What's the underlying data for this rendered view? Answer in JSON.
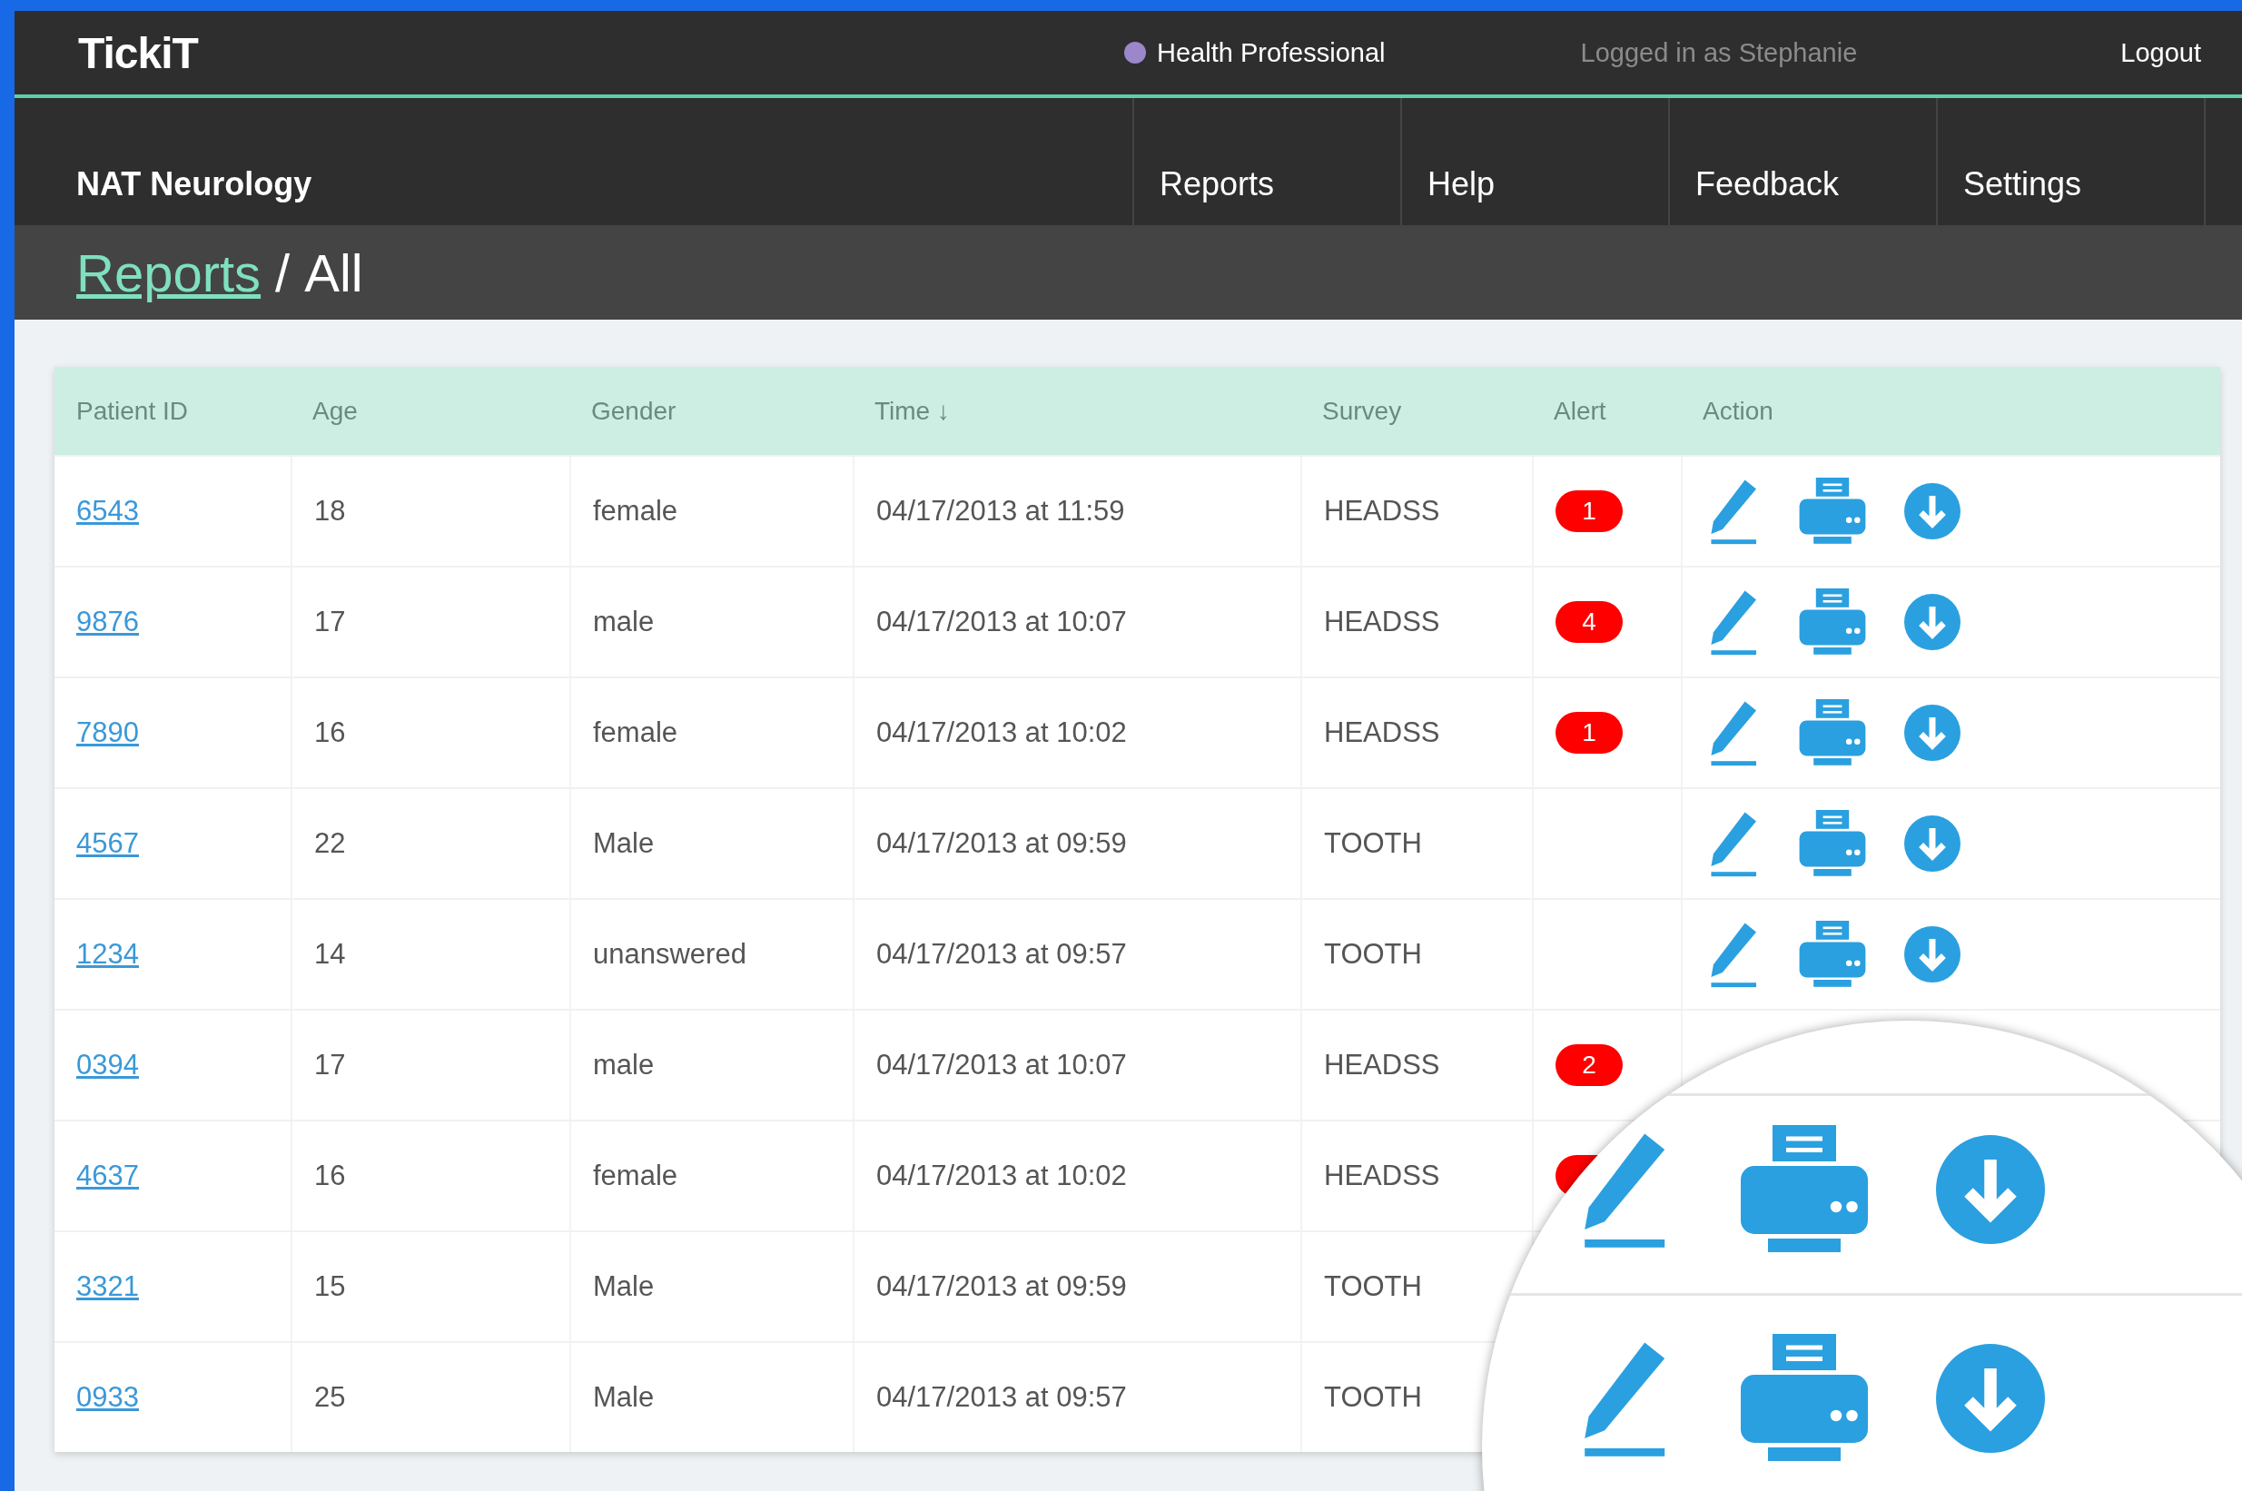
{
  "app": {
    "logo": "TickiT",
    "role": {
      "label": "Health Professional",
      "color": "#9b87c9"
    },
    "user": "Logged in as Stephanie",
    "logout": "Logout"
  },
  "nav": {
    "title": "NAT Neurology",
    "items": [
      {
        "label": "Reports",
        "selected": false
      },
      {
        "label": "Help",
        "selected": false
      },
      {
        "label": "Feedback",
        "selected": false
      },
      {
        "label": "Settings",
        "selected": false
      }
    ]
  },
  "breadcrumb": {
    "link": "Reports",
    "separator": "/",
    "current": "All"
  },
  "table": {
    "columns": [
      "Patient ID",
      "Age",
      "Gender",
      "Time ↓",
      "Survey",
      "Alert",
      "Action"
    ],
    "rows": [
      {
        "patient_id": "6543",
        "age": "18",
        "gender": "female",
        "time": "04/17/2013 at 11:59",
        "survey": "HEADSS",
        "alert": "1"
      },
      {
        "patient_id": "9876",
        "age": "17",
        "gender": "male",
        "time": "04/17/2013 at 10:07",
        "survey": "HEADSS",
        "alert": "4"
      },
      {
        "patient_id": "7890",
        "age": "16",
        "gender": "female",
        "time": "04/17/2013 at 10:02",
        "survey": "HEADSS",
        "alert": "1"
      },
      {
        "patient_id": "4567",
        "age": "22",
        "gender": "Male",
        "time": "04/17/2013 at 09:59",
        "survey": "TOOTH"
      },
      {
        "patient_id": "1234",
        "age": "14",
        "gender": "unanswered",
        "time": "04/17/2013 at 09:57",
        "survey": "TOOTH"
      },
      {
        "patient_id": "0394",
        "age": "17",
        "gender": "male",
        "time": "04/17/2013 at 10:07",
        "survey": "HEADSS",
        "alert": "2"
      },
      {
        "patient_id": "4637",
        "age": "16",
        "gender": "female",
        "time": "04/17/2013 at 10:02",
        "survey": "HEADSS",
        "alert_covered": true
      },
      {
        "patient_id": "3321",
        "age": "15",
        "gender": "Male",
        "time": "04/17/2013 at 09:59",
        "survey": "TOOTH"
      },
      {
        "patient_id": "0933",
        "age": "25",
        "gender": "Male",
        "time": "04/17/2013 at 09:57",
        "survey": "TOOTH"
      }
    ]
  }
}
